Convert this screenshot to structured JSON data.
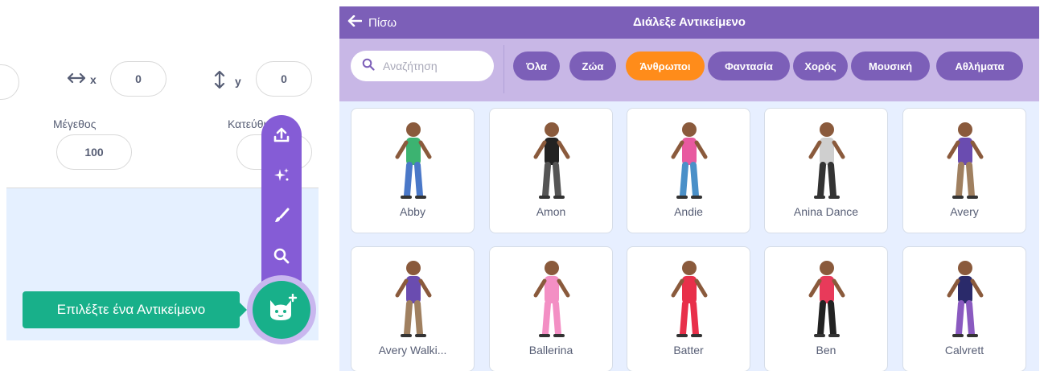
{
  "sprite_info": {
    "x_label": "x",
    "x_value": "0",
    "y_label": "y",
    "y_value": "0",
    "size_label": "Μέγεθος",
    "size_value": "100",
    "direction_label": "Κατεύθυνση"
  },
  "sprite_menu": {
    "items": [
      {
        "icon": "upload-icon"
      },
      {
        "icon": "surprise-sparkle-icon"
      },
      {
        "icon": "paint-brush-icon"
      },
      {
        "icon": "search-icon"
      }
    ],
    "choose_icon": "cat-plus-icon",
    "tooltip": "Επιλέξτε ένα Αντικείμενο"
  },
  "library": {
    "back_label": "Πίσω",
    "title": "Διάλεξε Αντικείμενο",
    "search_placeholder": "Αναζήτηση",
    "tags": [
      {
        "label": "Όλα",
        "active": false
      },
      {
        "label": "Ζώα",
        "active": false
      },
      {
        "label": "Άνθρωποι",
        "active": true
      },
      {
        "label": "Φαντασία",
        "active": false
      },
      {
        "label": "Χορός",
        "active": false
      },
      {
        "label": "Μουσική",
        "active": false
      },
      {
        "label": "Αθλήματα",
        "active": false
      }
    ],
    "sprites": [
      {
        "name": "Abby",
        "shirt": "#3cb371",
        "pants": "#4a78c8"
      },
      {
        "name": "Amon",
        "shirt": "#222222",
        "pants": "#555555"
      },
      {
        "name": "Andie",
        "shirt": "#e85aa0",
        "pants": "#4a90c8"
      },
      {
        "name": "Anina Dance",
        "shirt": "#cfcfcf",
        "pants": "#333333"
      },
      {
        "name": "Avery",
        "shirt": "#6a4cb0",
        "pants": "#a08060"
      },
      {
        "name": "Avery Walki...",
        "shirt": "#6a4cb0",
        "pants": "#a08060"
      },
      {
        "name": "Ballerina",
        "shirt": "#f38fc4",
        "pants": "#f38fc4"
      },
      {
        "name": "Batter",
        "shirt": "#e8304a",
        "pants": "#e8304a"
      },
      {
        "name": "Ben",
        "shirt": "#e83a5a",
        "pants": "#222222"
      },
      {
        "name": "Calvrett",
        "shirt": "#2a2a6a",
        "pants": "#8a5ac0"
      }
    ]
  },
  "colors": {
    "purple": "#7c5fb8",
    "accent_orange": "#ff8c1a",
    "teal": "#18b08a"
  }
}
